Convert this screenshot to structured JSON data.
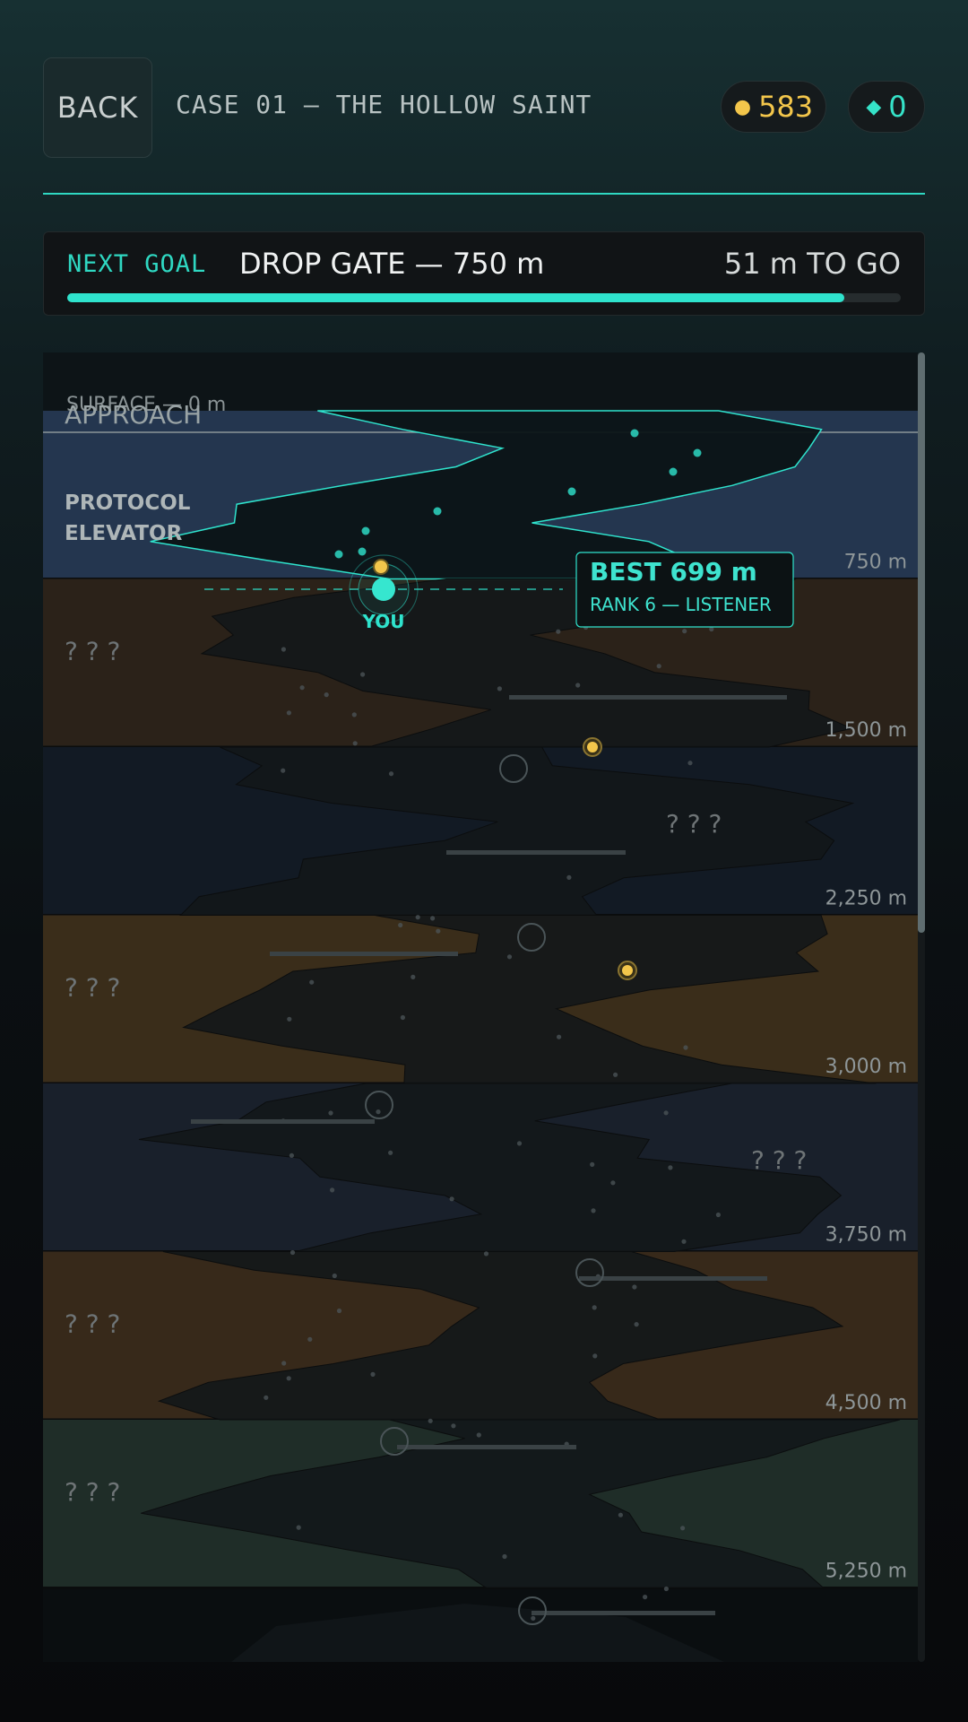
{
  "header": {
    "back_label": "BACK",
    "case_title": "CASE 01 — THE HOLLOW SAINT",
    "coins": "583",
    "gems": "0",
    "coin_icon": "coin-icon",
    "gem_icon": "diamond-icon"
  },
  "goal": {
    "label": "NEXT GOAL",
    "name": "DROP GATE — 750 m",
    "remaining": "51 m TO GO",
    "progress": 0.932
  },
  "map": {
    "surface_label": "SURFACE — 0 m",
    "approach_label": "APPROACH",
    "player_label": "YOU",
    "best_label": "BEST  699 m",
    "rank_label": "RANK 6 — LISTENER",
    "zones": [
      {
        "name": [
          "PROTOCOL",
          "ELEVATOR"
        ],
        "depth": "750 m",
        "color": "#24364f",
        "locked": false
      },
      {
        "name": [
          "? ? ?"
        ],
        "depth": "1,500 m",
        "color": "#2b2219",
        "locked": true
      },
      {
        "name": [
          "? ? ?"
        ],
        "depth": "2,250 m",
        "color": "#121a24",
        "locked": true
      },
      {
        "name": [
          "? ? ?"
        ],
        "depth": "3,000 m",
        "color": "#3a2d1a",
        "locked": true
      },
      {
        "name": [
          "? ? ?"
        ],
        "depth": "3,750 m",
        "color": "#19202b",
        "locked": true
      },
      {
        "name": [
          "? ? ?"
        ],
        "depth": "4,500 m",
        "color": "#37291a",
        "locked": true
      },
      {
        "name": [
          "? ? ?"
        ],
        "depth": "5,250 m",
        "color": "#1f2d28",
        "locked": true
      }
    ]
  },
  "colors": {
    "accent": "#2fe3cd",
    "coin": "#f3c64b",
    "gem": "#35e2c8"
  }
}
